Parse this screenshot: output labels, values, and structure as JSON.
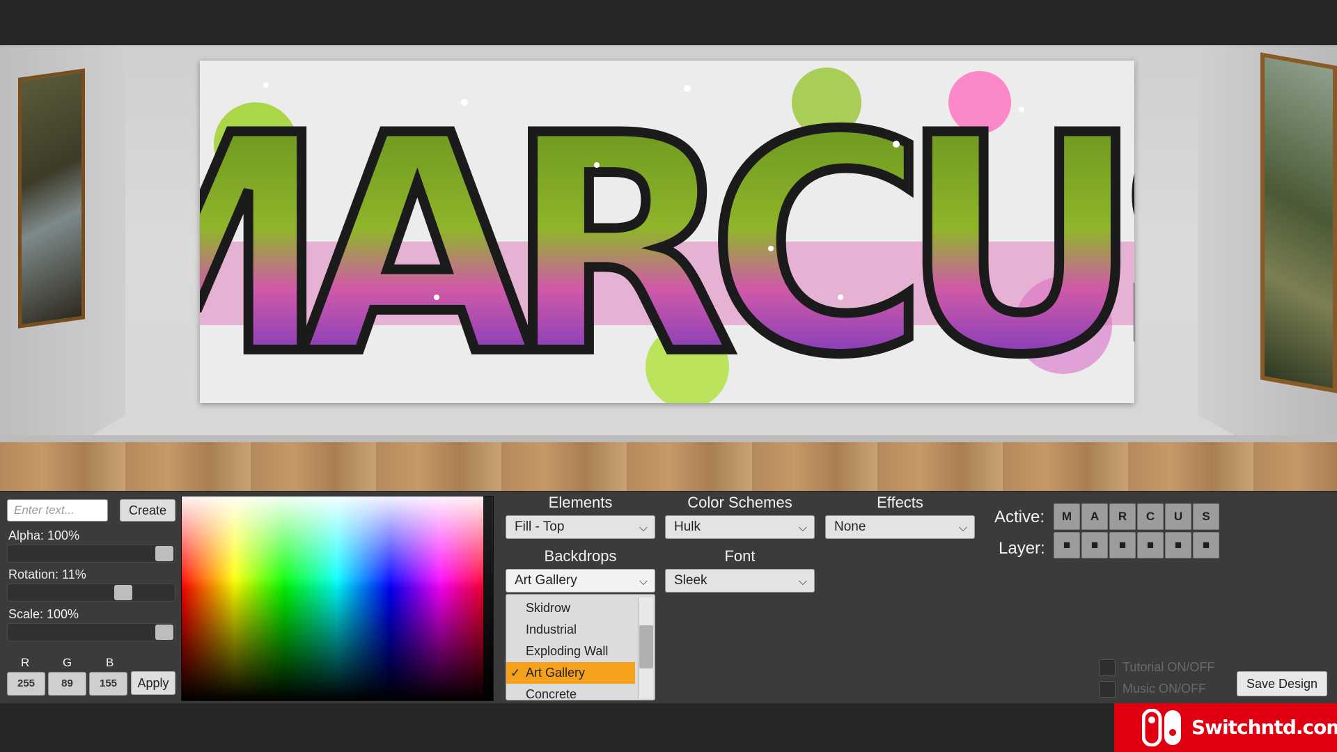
{
  "artwork": {
    "tag_text": "MARCUS"
  },
  "controls": {
    "text_input": {
      "placeholder": "Enter text..."
    },
    "create_label": "Create",
    "alpha_label": "Alpha: 100%",
    "alpha_value": 1.0,
    "rotation_label": "Rotation: 11%",
    "rotation_value": 0.11,
    "scale_label": "Scale: 100%",
    "scale_value": 1.0,
    "rgb": {
      "r_label": "R",
      "g_label": "G",
      "b_label": "B",
      "r_value": "255",
      "g_value": "89",
      "b_value": "155"
    },
    "apply_label": "Apply"
  },
  "sections": {
    "elements": {
      "title": "Elements",
      "selected": "Fill - Top"
    },
    "color_schemes": {
      "title": "Color Schemes",
      "selected": "Hulk"
    },
    "effects": {
      "title": "Effects",
      "selected": "None"
    },
    "backdrops": {
      "title": "Backdrops",
      "selected": "Art Gallery",
      "options": [
        "Skidrow",
        "Industrial",
        "Exploding Wall",
        "Art Gallery",
        "Concrete"
      ]
    },
    "font": {
      "title": "Font",
      "selected": "Sleek"
    }
  },
  "layers": {
    "active_label": "Active:",
    "layer_label": "Layer:",
    "letters": [
      "M",
      "A",
      "R",
      "C",
      "U",
      "S"
    ],
    "layer_mark": "■"
  },
  "toggles": {
    "tutorial": "Tutorial ON/OFF",
    "music": "Music ON/OFF"
  },
  "save_label": "Save Design",
  "brand": {
    "text": "Switchntd.com"
  },
  "colors": {
    "panel": "#3b3b3b",
    "accent_selected": "#f5a11c",
    "graffiti_green": "#6f9a1e",
    "graffiti_pink": "#e24aa8",
    "graffiti_purple": "#6a1f96",
    "brand_red": "#e10012"
  }
}
